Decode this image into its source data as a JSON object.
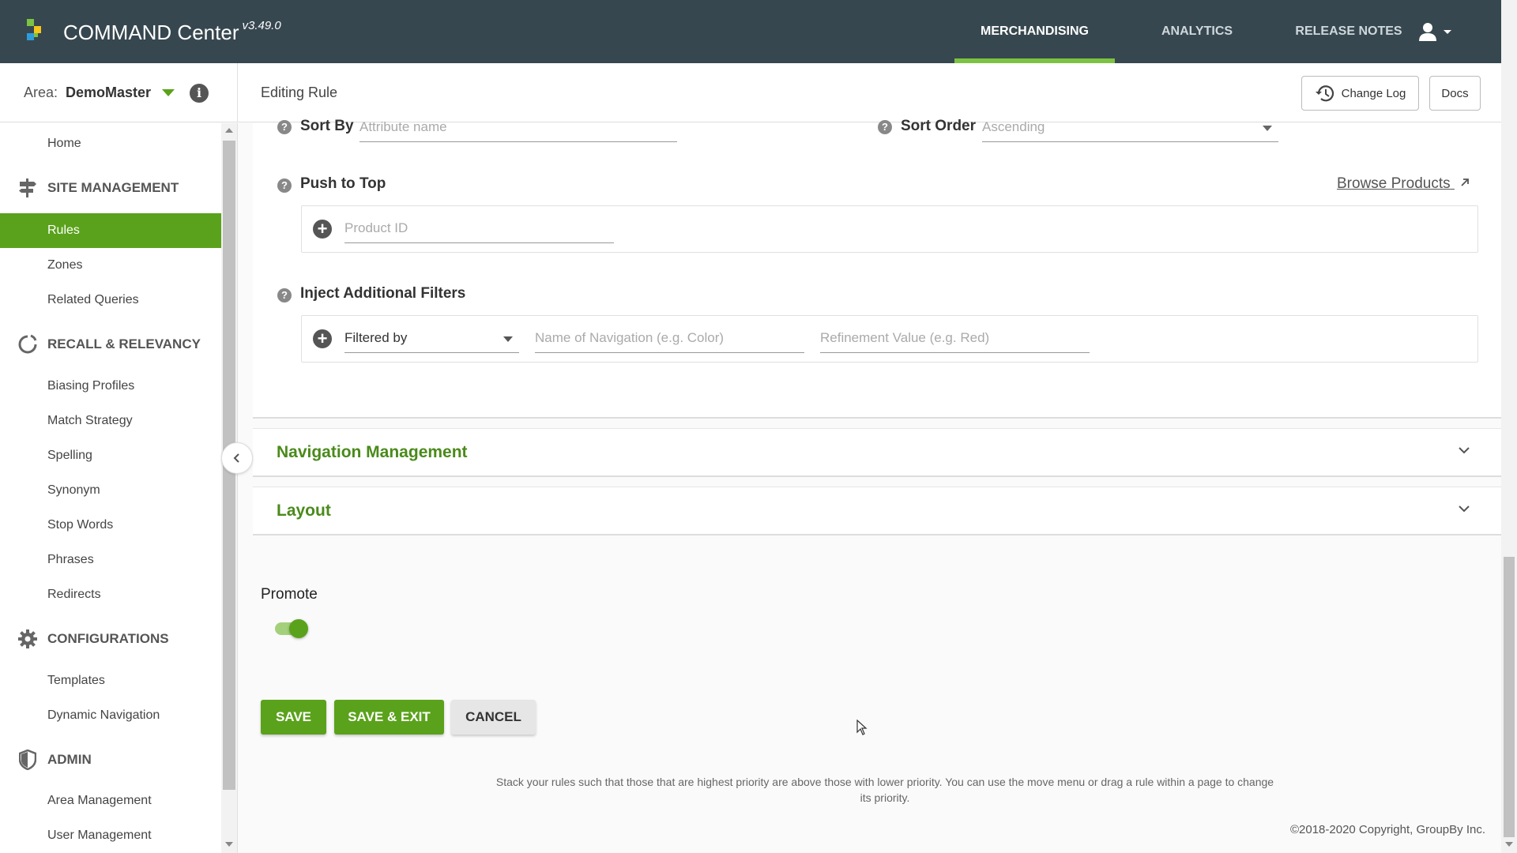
{
  "app": {
    "title": "COMMAND Center",
    "version": "v3.49.0",
    "brand_green": "#5aa21b",
    "header_bg": "#37474f"
  },
  "nav": {
    "tabs": [
      {
        "label": "MERCHANDISING",
        "active": true
      },
      {
        "label": "ANALYTICS",
        "active": false
      },
      {
        "label": "RELEASE NOTES",
        "active": false
      }
    ],
    "user_icon": "user-icon"
  },
  "subheader": {
    "area_label": "Area:",
    "area_name": "DemoMaster",
    "page_title": "Editing Rule",
    "change_log_label": "Change Log",
    "docs_label": "Docs"
  },
  "sidebar": {
    "items": [
      {
        "type": "item",
        "label": "Home"
      },
      {
        "type": "section",
        "label": "SITE MANAGEMENT",
        "icon": "signpost-icon"
      },
      {
        "type": "item",
        "label": "Rules",
        "active": true
      },
      {
        "type": "item",
        "label": "Zones"
      },
      {
        "type": "item",
        "label": "Related Queries"
      },
      {
        "type": "section",
        "label": "RECALL & RELEVANCY",
        "icon": "cycle-icon"
      },
      {
        "type": "item",
        "label": "Biasing Profiles"
      },
      {
        "type": "item",
        "label": "Match Strategy"
      },
      {
        "type": "item",
        "label": "Spelling"
      },
      {
        "type": "item",
        "label": "Synonym"
      },
      {
        "type": "item",
        "label": "Stop Words"
      },
      {
        "type": "item",
        "label": "Phrases"
      },
      {
        "type": "item",
        "label": "Redirects"
      },
      {
        "type": "section",
        "label": "CONFIGURATIONS",
        "icon": "gear-icon"
      },
      {
        "type": "item",
        "label": "Templates"
      },
      {
        "type": "item",
        "label": "Dynamic Navigation"
      },
      {
        "type": "section",
        "label": "ADMIN",
        "icon": "shield-icon"
      },
      {
        "type": "item",
        "label": "Area Management"
      },
      {
        "type": "item",
        "label": "User Management"
      }
    ]
  },
  "form": {
    "sort_by_label": "Sort By",
    "sort_by_placeholder": "Attribute name",
    "sort_order_label": "Sort Order",
    "sort_order_value": "Ascending",
    "push_to_top_label": "Push to Top",
    "browse_products_label": "Browse Products",
    "product_id_placeholder": "Product ID",
    "inject_filters_label": "Inject Additional Filters",
    "filtered_by_value": "Filtered by",
    "navigation_name_placeholder": "Name of Navigation (e.g. Color)",
    "refinement_value_placeholder": "Refinement Value (e.g. Red)"
  },
  "accordions": [
    {
      "title": "Navigation Management"
    },
    {
      "title": "Layout"
    }
  ],
  "promote": {
    "label": "Promote",
    "enabled": true
  },
  "actions": {
    "save_label": "SAVE",
    "save_exit_label": "SAVE & EXIT",
    "cancel_label": "CANCEL"
  },
  "footer": {
    "note": "Stack your rules such that those that are highest priority are above those with lower priority. You can use the move menu or drag a rule within a page to change its priority.",
    "copyright": "©2018-2020 Copyright, GroupBy Inc."
  }
}
